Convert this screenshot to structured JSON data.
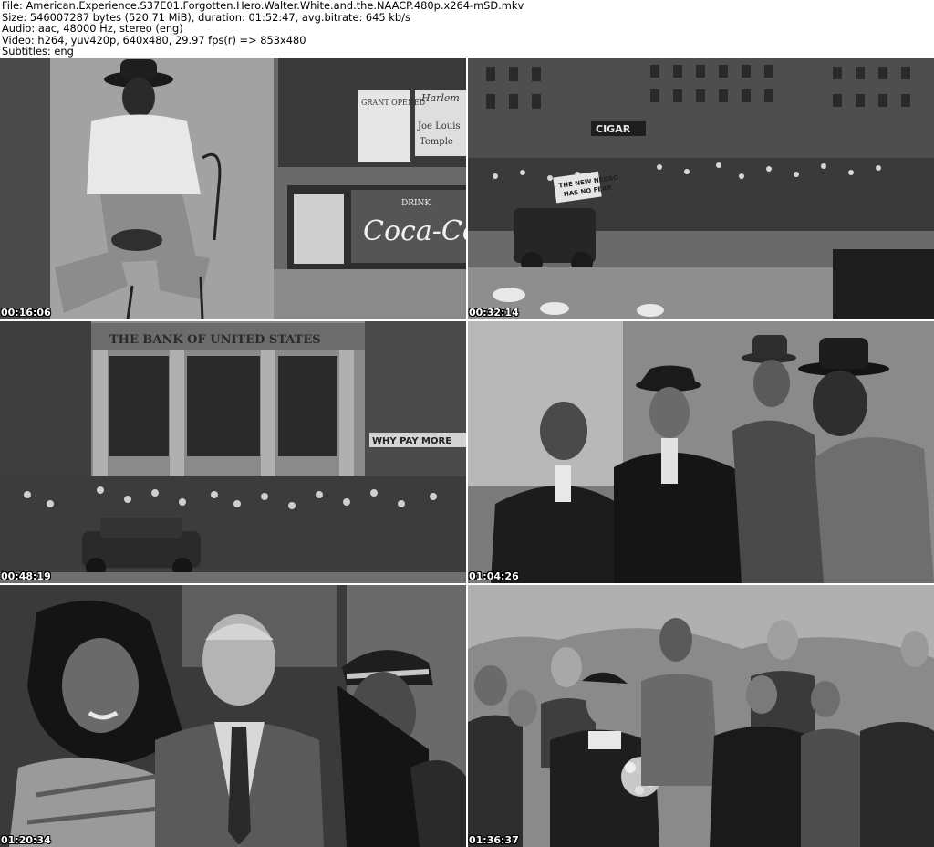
{
  "header": {
    "line1": "File: American.Experience.S37E01.Forgotten.Hero.Walter.White.and.the.NAACP.480p.x264-mSD.mkv",
    "line2": "Size: 546007287 bytes (520.71 MiB), duration: 01:52:47, avg.bitrate: 645 kb/s",
    "line3": "Audio: aac, 48000 Hz, stereo (eng)",
    "line4": "Video: h264, yuv420p, 640x480, 29.97 fps(r) => 853x480",
    "line5": "Subtitles: eng"
  },
  "thumbnails": [
    {
      "timestamp": "00:16:06",
      "signs": [
        "GRANT OPENED",
        "Harlem",
        "Joe Louis",
        "Temple",
        "DRINK",
        "Coca-Co"
      ]
    },
    {
      "timestamp": "00:32:14",
      "signs": [
        "CIGAR",
        "THE NEW NEGRO",
        "HAS NO FEAR"
      ]
    },
    {
      "timestamp": "00:48:19",
      "signs": [
        "THE BANK OF UNITED STATES",
        "WHY PAY MORE"
      ]
    },
    {
      "timestamp": "01:04:26",
      "signs": []
    },
    {
      "timestamp": "01:20:34",
      "signs": []
    },
    {
      "timestamp": "01:36:37",
      "signs": []
    }
  ],
  "colors": {
    "background": "#ffffff",
    "header_text": "#000000",
    "timestamp_text": "#ffffff",
    "timestamp_outline": "#000000"
  }
}
